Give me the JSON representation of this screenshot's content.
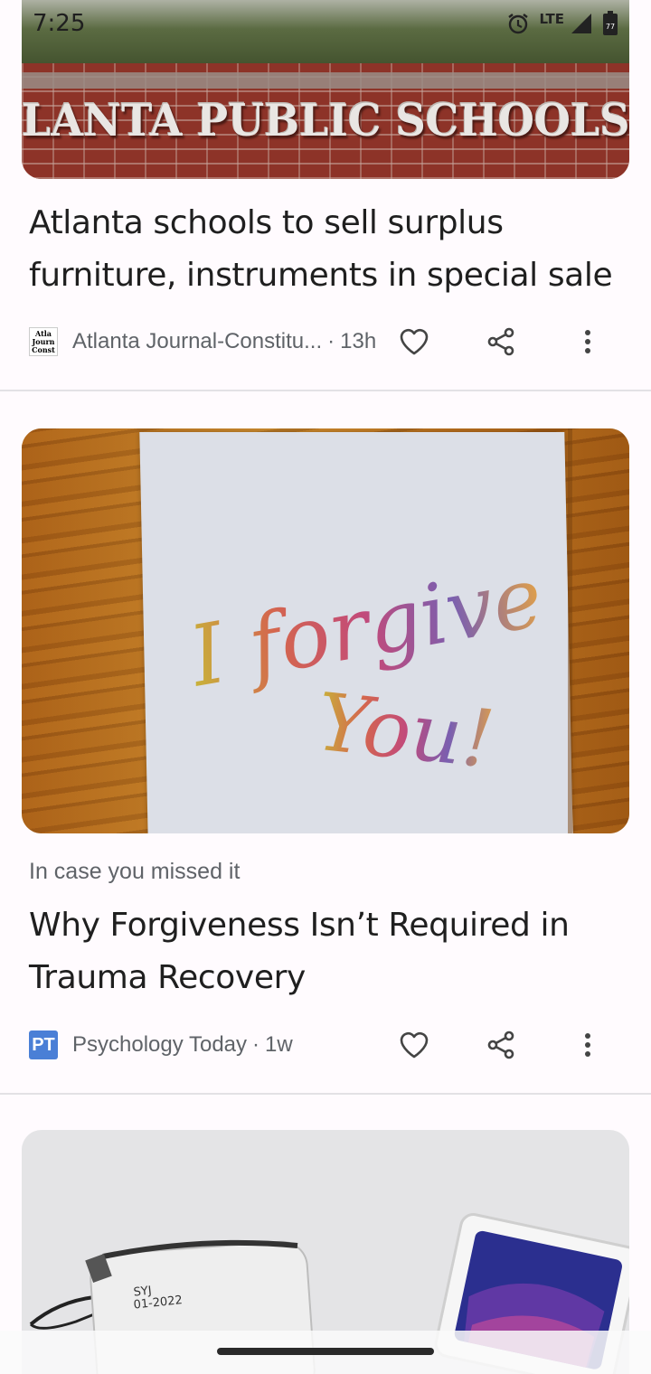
{
  "status_bar": {
    "time": "7:25",
    "network": "LTE",
    "battery_level": "77"
  },
  "articles": [
    {
      "image_sign_text": "LANTA PUBLIC SCHOOLS",
      "headline": "Atlanta schools to sell surplus furniture, instruments in special sale",
      "source_logo_text": "Atla Journ Const",
      "source": "Atlanta Journal-Constitu...",
      "age": "13h"
    },
    {
      "kicker": "In case you missed it",
      "image_note_line1": "I forgive",
      "image_note_line2": "You!",
      "headline": "Why Forgiveness Isn’t Required in Trauma Recovery",
      "source_logo_text": "PT",
      "source": "Psychology Today",
      "age": "1w"
    },
    {
      "image_label_line1": "SYJ",
      "image_label_line2": "01-2022"
    }
  ],
  "meta_separator": "·",
  "colors": {
    "background": "#fffbfe",
    "headline": "#1f1f1f",
    "secondary_text": "#5f6368",
    "divider": "#e3e1e5",
    "pt_logo": "#4a7fd6"
  }
}
